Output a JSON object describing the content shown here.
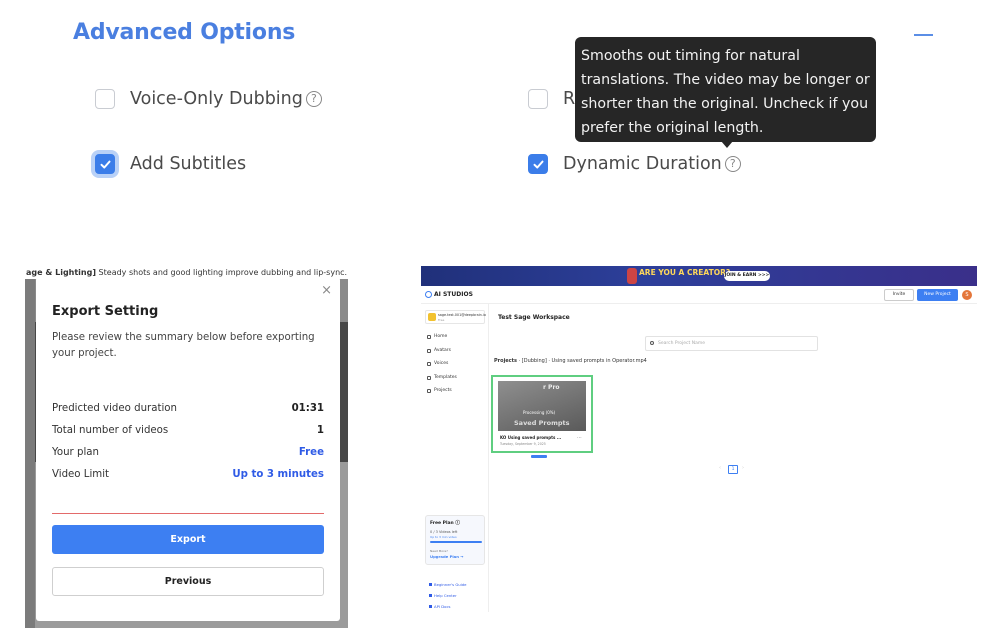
{
  "advanced": {
    "title": "Advanced Options",
    "options": {
      "voice_only": {
        "label": "Voice-Only Dubbing",
        "checked": false
      },
      "hidden_option": {
        "label_prefix": "R",
        "checked": false
      },
      "add_subtitles": {
        "label": "Add Subtitles",
        "checked": true
      },
      "dynamic_duration": {
        "label": "Dynamic Duration",
        "checked": true
      }
    },
    "help_glyph": "?",
    "tooltip": "Smooths out timing for natural translations. The video may be longer or shorter than the original. Uncheck if you prefer the original length.",
    "accent": "#3b7de9"
  },
  "export_dialog": {
    "background_caption_bold": "age & Lighting]",
    "background_caption_text": " Steady shots and good lighting improve dubbing and lip-sync.",
    "title": "Export Setting",
    "description": "Please review the summary below before exporting your project.",
    "rows": [
      {
        "label": "Predicted video duration",
        "value": "01:31"
      },
      {
        "label": "Total number of videos",
        "value": "1"
      },
      {
        "label": "Your plan",
        "value": "Free"
      },
      {
        "label": "Video Limit",
        "value": "Up to 3 minutes"
      }
    ],
    "export_label": "Export",
    "previous_label": "Previous",
    "close_glyph": "×"
  },
  "studio": {
    "banner": {
      "title": "ARE YOU A CREATOR?",
      "button": "JOIN & EARN >>>"
    },
    "logo": "AI STUDIOS",
    "invite": "Invite",
    "new_project": "New Project",
    "avatar_initial": "S",
    "workspace_chip": {
      "name": "sage.test.001@deepbrain.io",
      "plan": "Free"
    },
    "nav": [
      "Home",
      "Avatars",
      "Voices",
      "Templates",
      "Projects"
    ],
    "workspace_title": "Test Sage Workspace",
    "search_placeholder": "Search Project Name",
    "breadcrumb_bold": "Projects",
    "breadcrumb_rest": " · [Dubbing] · Using saved prompts in Operator.mp4",
    "card": {
      "overlay_top": "r Pro",
      "overlay_mid": "Processing (0%)",
      "overlay_bottom": "Saved Prompts",
      "title": "KO Using saved prompts ...",
      "date": "Tuesday, September 9, 2025"
    },
    "plan_card": {
      "title": "Free Plan ⓘ",
      "videos_left": "0 / 3 Videos left",
      "limit": "Up to 3 min video",
      "need_more": "Need More?",
      "upgrade": "Upgrade Plan →"
    },
    "footer_links": [
      "Beginner's Guide",
      "Help Center",
      "API Docs"
    ],
    "page_number": "1"
  }
}
